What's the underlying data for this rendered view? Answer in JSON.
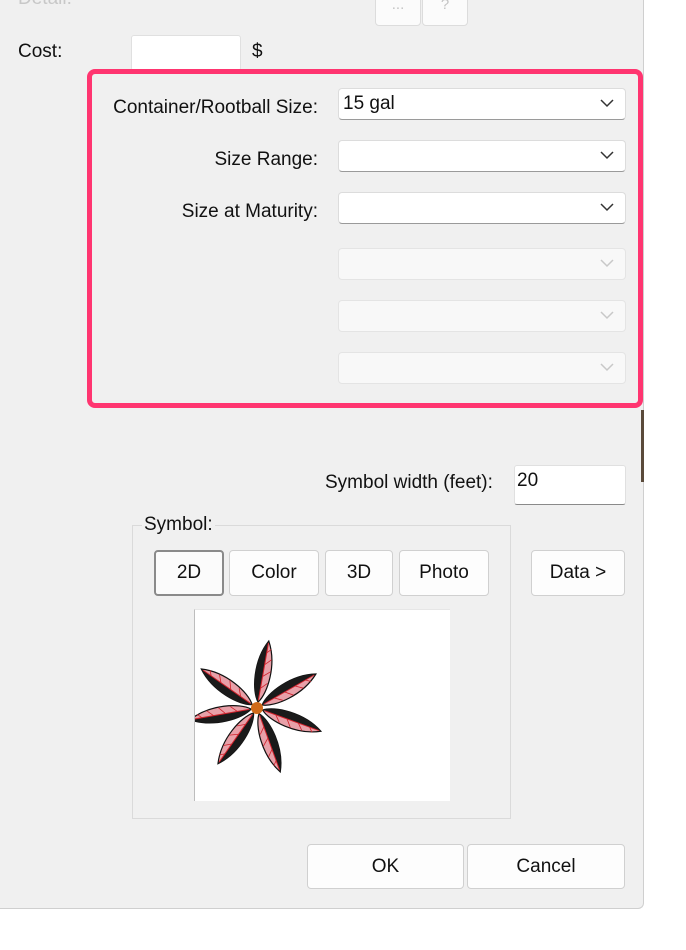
{
  "top_row": {
    "label": "Detail:",
    "button_1": "...",
    "button_2": "?"
  },
  "cost": {
    "label": "Cost:",
    "value": "",
    "unit": "$"
  },
  "sizes": {
    "container_label": "Container/Rootball Size:",
    "container_value": "15 gal",
    "range_label": "Size Range:",
    "range_value": "",
    "maturity_label": "Size at Maturity:",
    "maturity_value": ""
  },
  "symbol_width": {
    "label": "Symbol width (feet):",
    "value": "20"
  },
  "symbol": {
    "group_label": "Symbol:",
    "tabs": [
      "2D",
      "Color",
      "3D",
      "Photo"
    ],
    "selected_tab": "2D",
    "data_button": "Data >"
  },
  "footer": {
    "ok": "OK",
    "cancel": "Cancel"
  },
  "colors": {
    "highlight": "#ff3570",
    "dialog_bg": "#f0f0f0",
    "leaf_dark": "#1a1a1a",
    "leaf_pink": "#e8a0a8",
    "leaf_vein": "#d0202a",
    "center": "#d06a1a"
  }
}
